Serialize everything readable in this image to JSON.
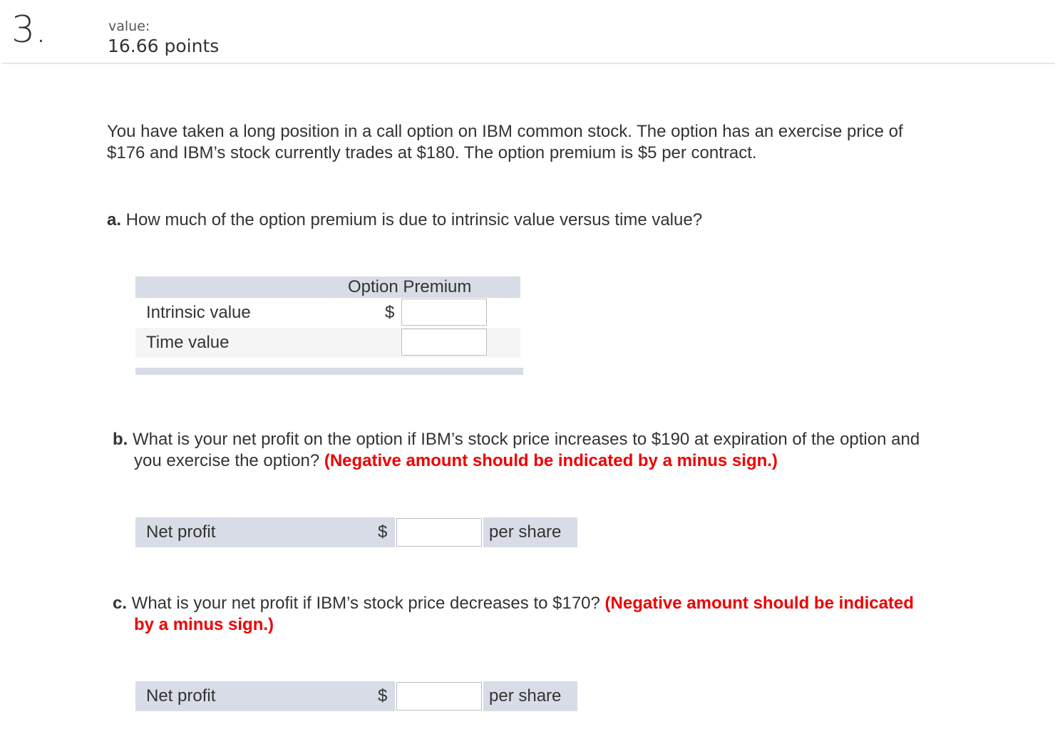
{
  "header": {
    "question_number": "3.",
    "value_label": "value:",
    "points": "16.66 points"
  },
  "intro": {
    "line1": "You have taken a long position in a call option on IBM common stock. The option has an exercise price of",
    "line2": "$176 and IBM’s stock currently trades at $180. The option premium is $5 per contract."
  },
  "part_a": {
    "letter": "a.",
    "question": " How much of the option premium is due to intrinsic value versus time value?",
    "table": {
      "column_header": "Option Premium",
      "rows": [
        {
          "label": "Intrinsic value",
          "currency": "$",
          "value": ""
        },
        {
          "label": "Time value",
          "currency": "",
          "value": ""
        }
      ]
    }
  },
  "part_b": {
    "letter": "b.",
    "line1": " What is your net profit on the option if IBM’s stock price increases to $190 at expiration of the option and",
    "line2": "you exercise the option? ",
    "note": "(Negative amount should be indicated by a minus sign.)",
    "row": {
      "label": "Net profit",
      "currency": "$",
      "value": "",
      "unit": "per share"
    }
  },
  "part_c": {
    "letter": "c.",
    "line1": " What is your net profit if IBM’s stock price decreases to $170? ",
    "note_line1": "(Negative amount should be indicated",
    "note_line2": "by a minus sign.)",
    "row": {
      "label": "Net profit",
      "currency": "$",
      "value": "",
      "unit": "per share"
    }
  },
  "colors": {
    "note_red": "#ee0000",
    "table_header_bg": "#d8dce6",
    "alt_row_bg": "#f5f5f5"
  }
}
